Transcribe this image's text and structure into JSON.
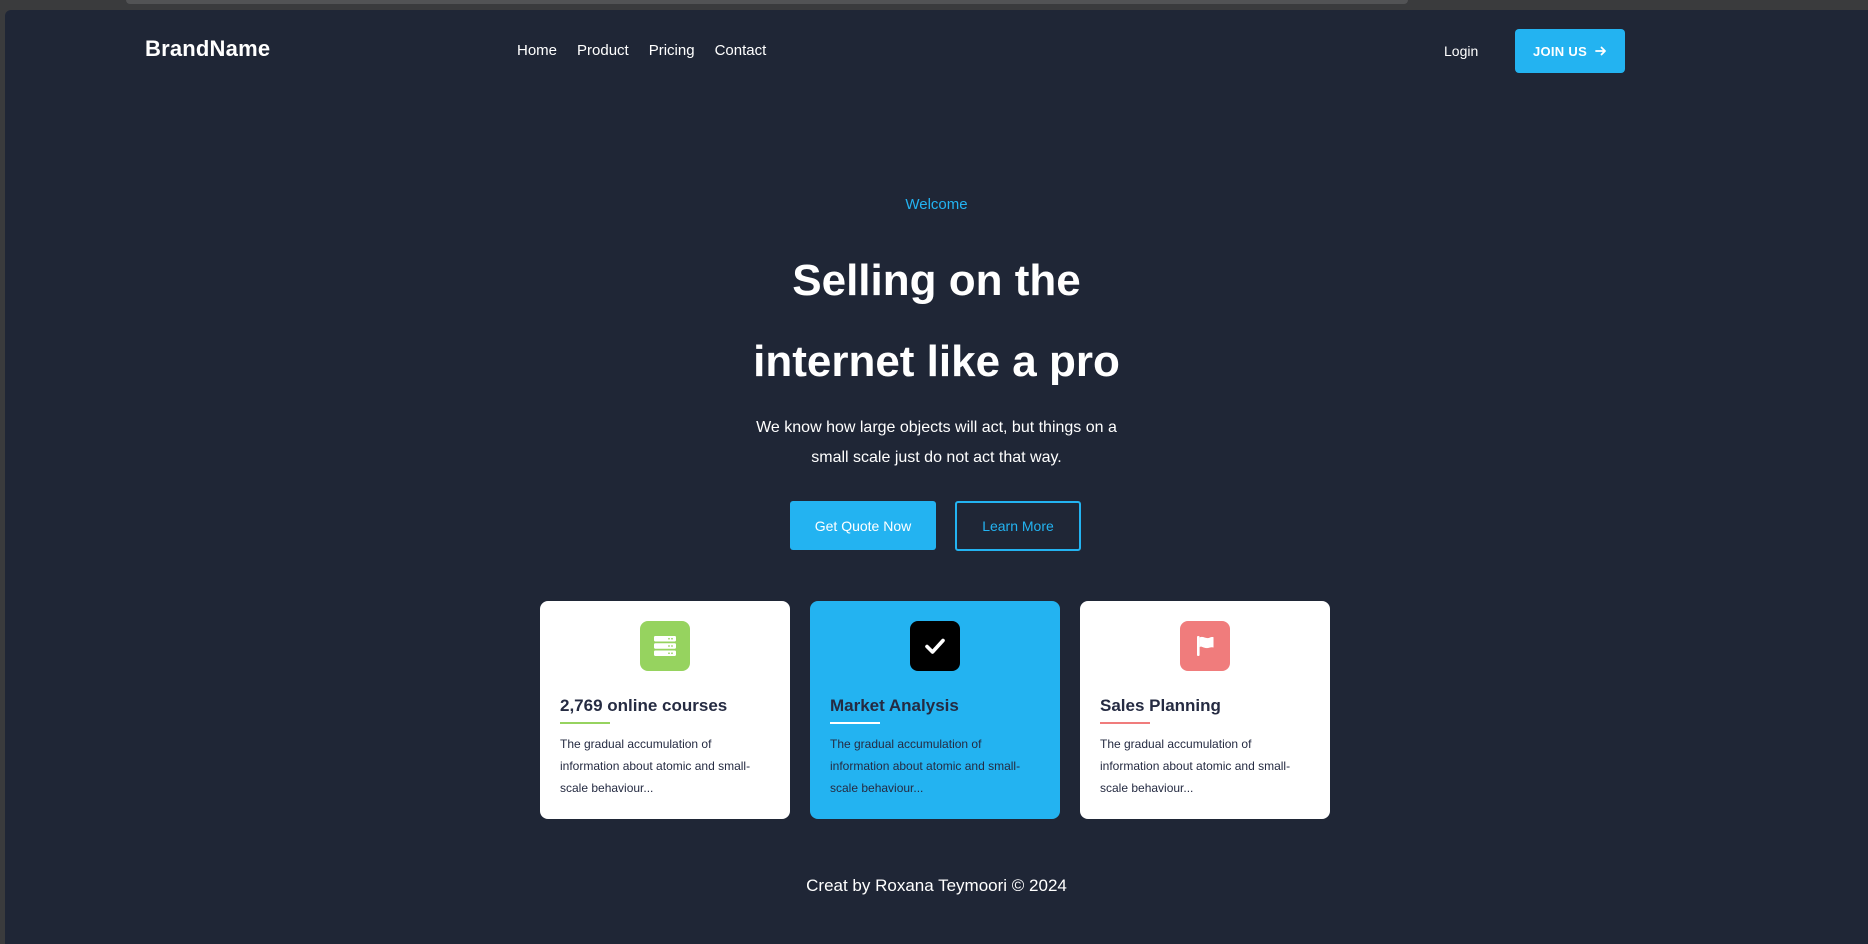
{
  "header": {
    "brand": "BrandName",
    "nav": [
      "Home",
      "Product",
      "Pricing",
      "Contact"
    ],
    "login": "Login",
    "join": "JOIN US"
  },
  "hero": {
    "eyebrow": "Welcome",
    "headline_line1": "Selling on the",
    "headline_line2": "internet like a pro",
    "sub_line1": "We know how large objects will act, but things on a",
    "sub_line2": "small scale just do not act that way.",
    "primary_button": "Get Quote Now",
    "secondary_button": "Learn More"
  },
  "cards": [
    {
      "icon": "server-stack-icon",
      "title": "2,769 online courses",
      "desc": "The gradual accumulation of information about atomic and small-scale behaviour...",
      "accent": "#96d35f",
      "background": "#ffffff"
    },
    {
      "icon": "checkmark-icon",
      "title": "Market Analysis",
      "desc": "The gradual accumulation of information about atomic and small-scale behaviour...",
      "accent": "#ffffff",
      "background": "#23b3f1"
    },
    {
      "icon": "flag-icon",
      "title": "Sales Planning",
      "desc": "The gradual accumulation of information about atomic and small-scale behaviour...",
      "accent": "#f07c7c",
      "background": "#ffffff"
    }
  ],
  "footer": {
    "text": "Creat by Roxana Teymoori © 2024"
  },
  "colors": {
    "page_bg": "#1f2636",
    "primary": "#23b3f1",
    "card_text": "#252b42"
  }
}
